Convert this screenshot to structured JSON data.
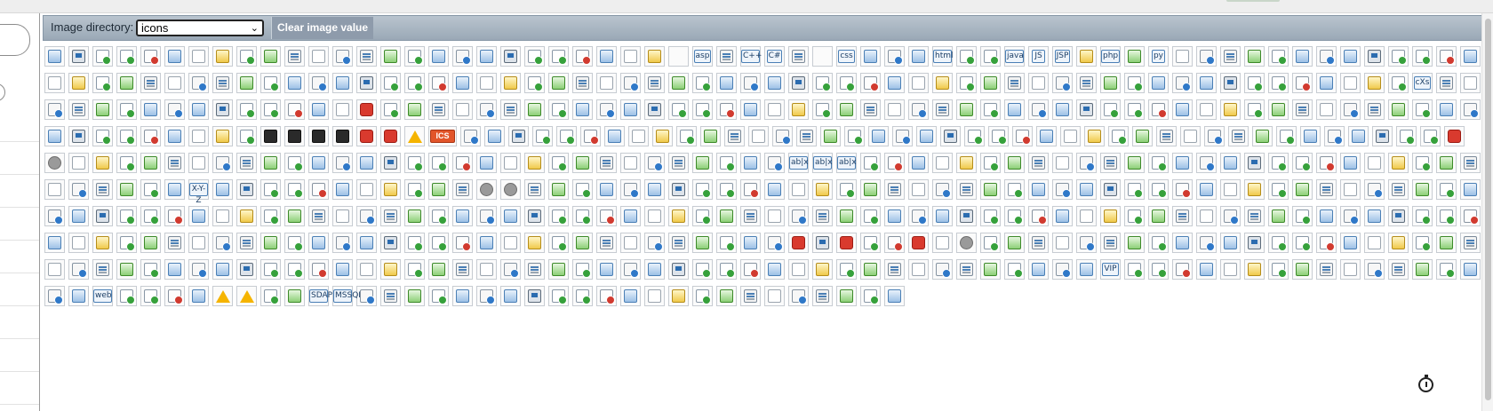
{
  "toolbar": {
    "dir_label": "Image directory:",
    "dir_value": "icons",
    "clear_label": "Clear image value"
  },
  "text_icons": {
    "asp": "asp",
    "cpp": "C++",
    "cs": "C#",
    "css": "css",
    "html": "html",
    "java": "java",
    "js": "JS",
    "jsp": "JSP",
    "php": "php",
    "py": "py",
    "cxs": "cXs",
    "abx": "ab|x",
    "xyz": "X-Y-Z",
    "ics": "ICS",
    "sdap": "SDAP",
    "mssql": "MSSQL",
    "vip": "VIP",
    "web": "web"
  },
  "icon_colors": {
    "blue": "#4a7fb5",
    "green": "#36a13b",
    "red": "#d13a2f",
    "yellow": "#f0c94a",
    "orange": "#e2552a",
    "toolbar": "#9aa8b6"
  }
}
